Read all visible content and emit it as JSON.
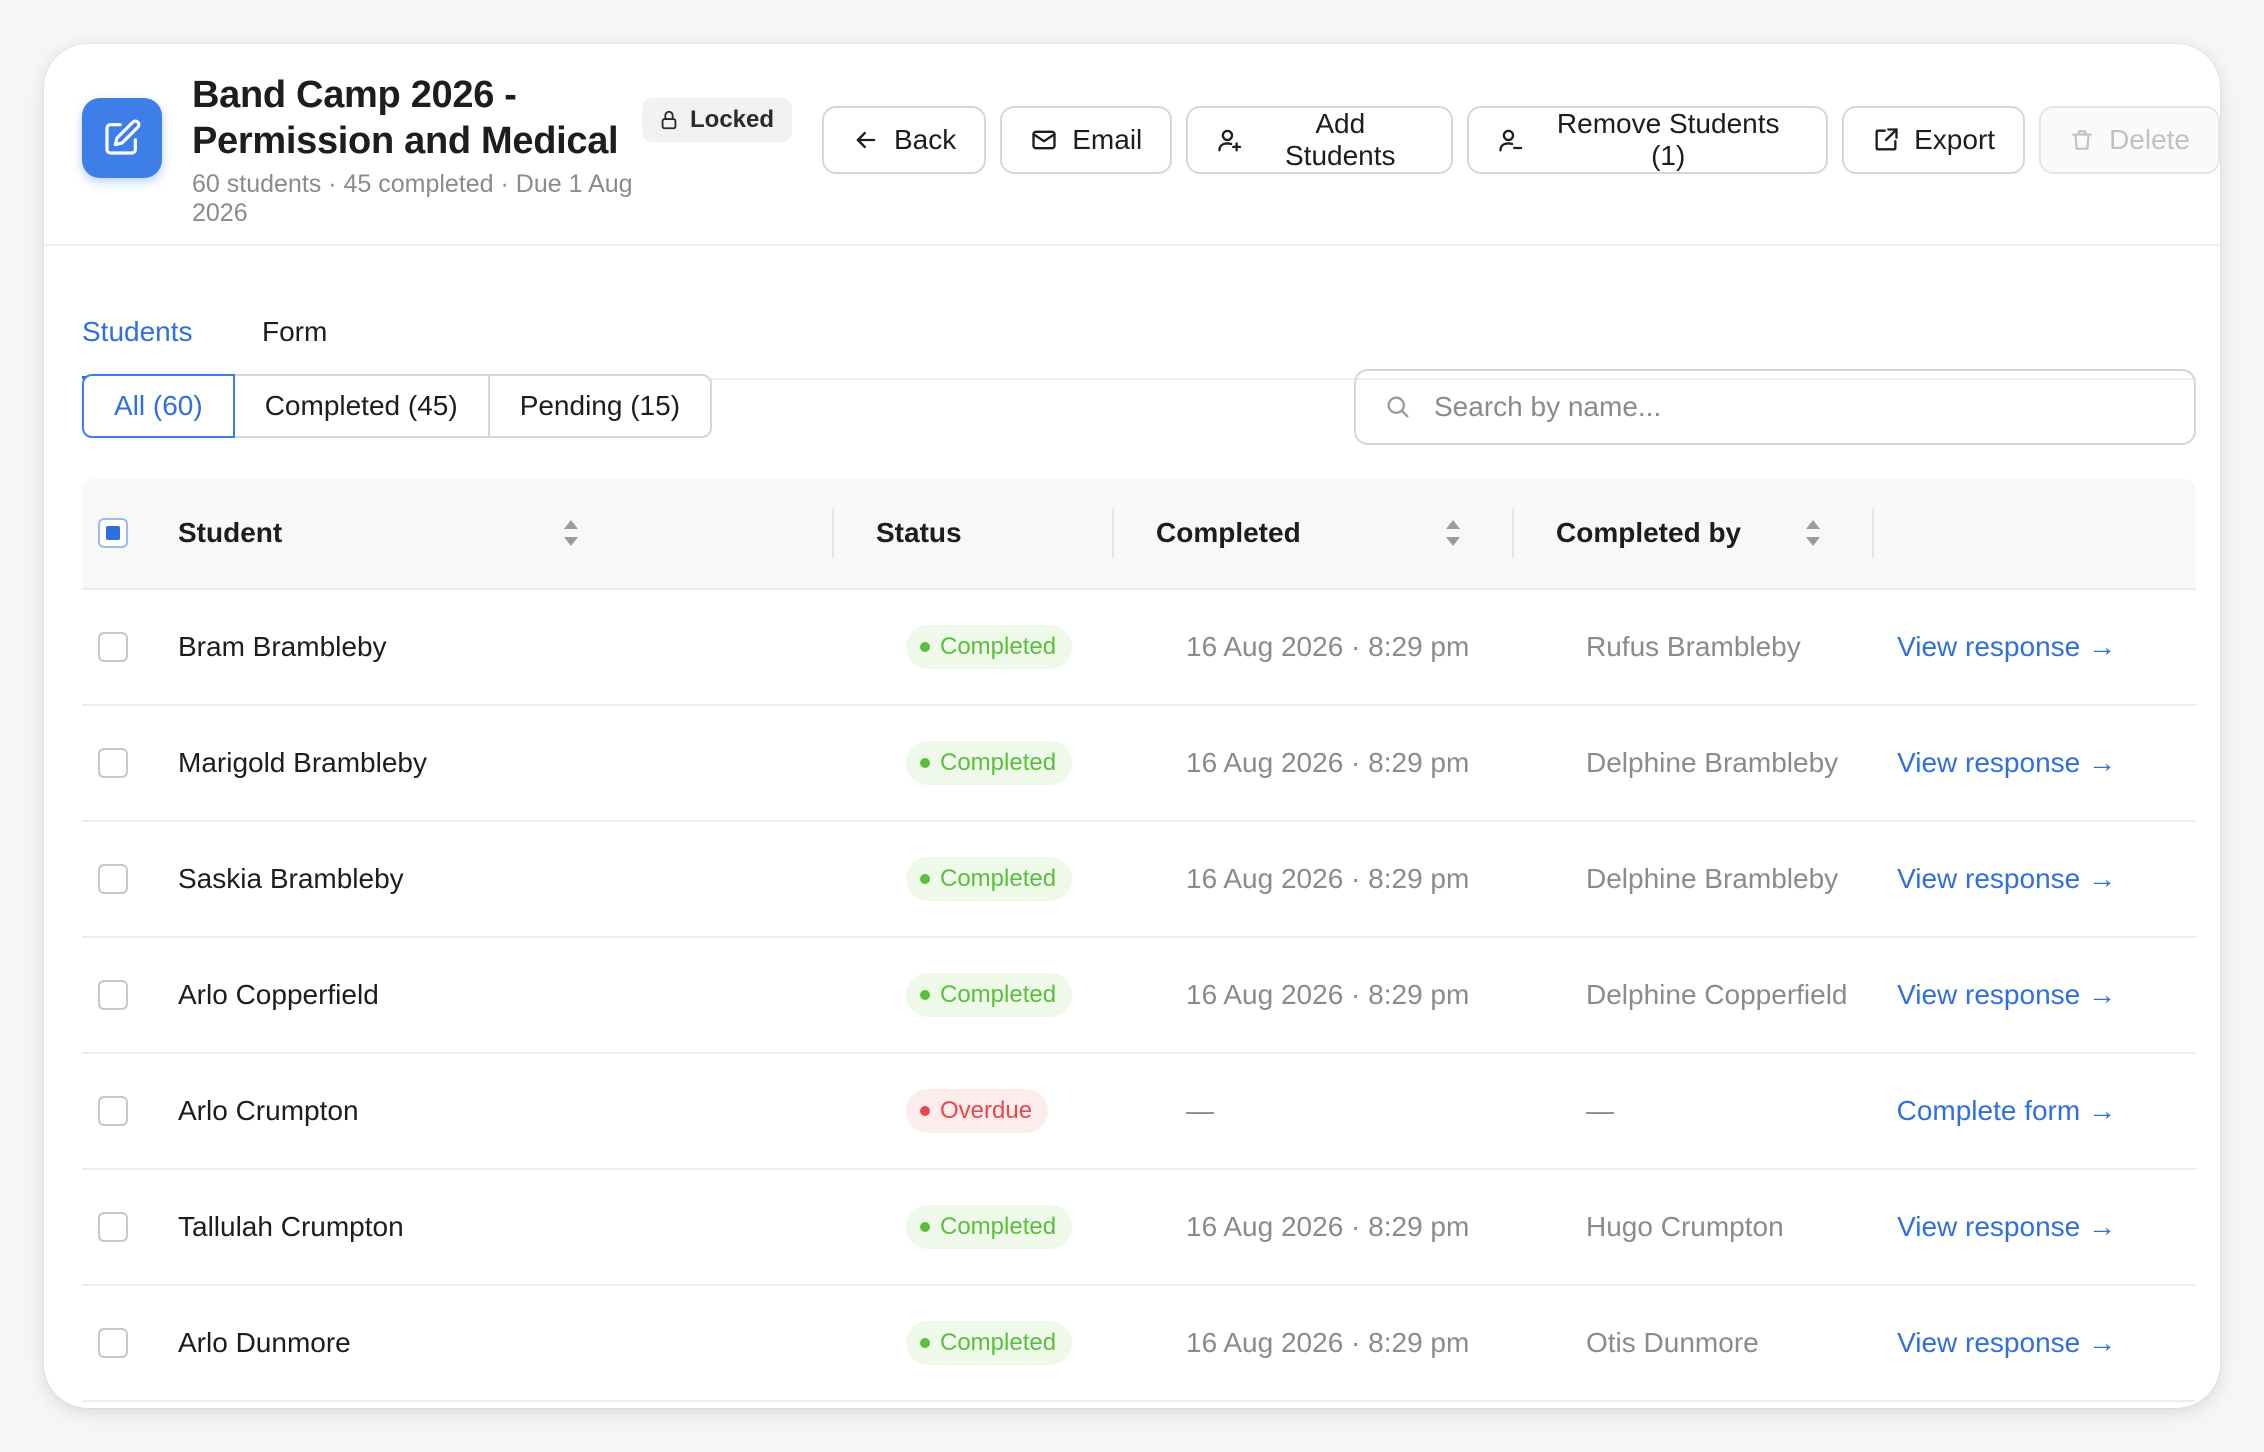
{
  "header": {
    "title_line1": "Band Camp 2026 -",
    "title_line2": "Permission and Medical",
    "subtitle": "60 students · 45 completed · Due 1 Aug 2026",
    "locked_label": "Locked",
    "icon": "edit-note-icon"
  },
  "actions": {
    "back": "Back",
    "email": "Email",
    "add_students": "Add Students",
    "remove_students": "Remove Students (1)",
    "export": "Export",
    "delete": "Delete"
  },
  "tabs": [
    {
      "label": "Students",
      "active": true
    },
    {
      "label": "Form",
      "active": false
    }
  ],
  "filters": [
    {
      "label": "All (60)",
      "active": true
    },
    {
      "label": "Completed (45)",
      "active": false
    },
    {
      "label": "Pending (15)",
      "active": false
    }
  ],
  "search": {
    "placeholder": "Search by name..."
  },
  "table": {
    "columns": {
      "student": "Student",
      "status": "Status",
      "completed": "Completed",
      "completed_by": "Completed by"
    },
    "rows": [
      {
        "student": "Bram Brambleby",
        "status": "Completed",
        "completed": "16 Aug 2026 · 8:29 pm",
        "completed_by": "Rufus Brambleby",
        "action": "View response →"
      },
      {
        "student": "Marigold Brambleby",
        "status": "Completed",
        "completed": "16 Aug 2026 · 8:29 pm",
        "completed_by": "Delphine Brambleby",
        "action": "View response →"
      },
      {
        "student": "Saskia Brambleby",
        "status": "Completed",
        "completed": "16 Aug 2026 · 8:29 pm",
        "completed_by": "Delphine Brambleby",
        "action": "View response →"
      },
      {
        "student": "Arlo Copperfield",
        "status": "Completed",
        "completed": "16 Aug 2026 · 8:29 pm",
        "completed_by": "Delphine Copperfield",
        "action": "View response →"
      },
      {
        "student": "Arlo Crumpton",
        "status": "Overdue",
        "completed": "—",
        "completed_by": "—",
        "action": "Complete form →"
      },
      {
        "student": "Tallulah Crumpton",
        "status": "Completed",
        "completed": "16 Aug 2026 · 8:29 pm",
        "completed_by": "Hugo Crumpton",
        "action": "View response →"
      },
      {
        "student": "Arlo Dunmore",
        "status": "Completed",
        "completed": "16 Aug 2026 · 8:29 pm",
        "completed_by": "Otis Dunmore",
        "action": "View response →"
      }
    ]
  },
  "colors": {
    "accent": "#2f6fde",
    "completed_bg": "#eef9ea",
    "completed_text": "#5bbf3e",
    "overdue_bg": "#fdecec",
    "overdue_text": "#e5484d"
  }
}
